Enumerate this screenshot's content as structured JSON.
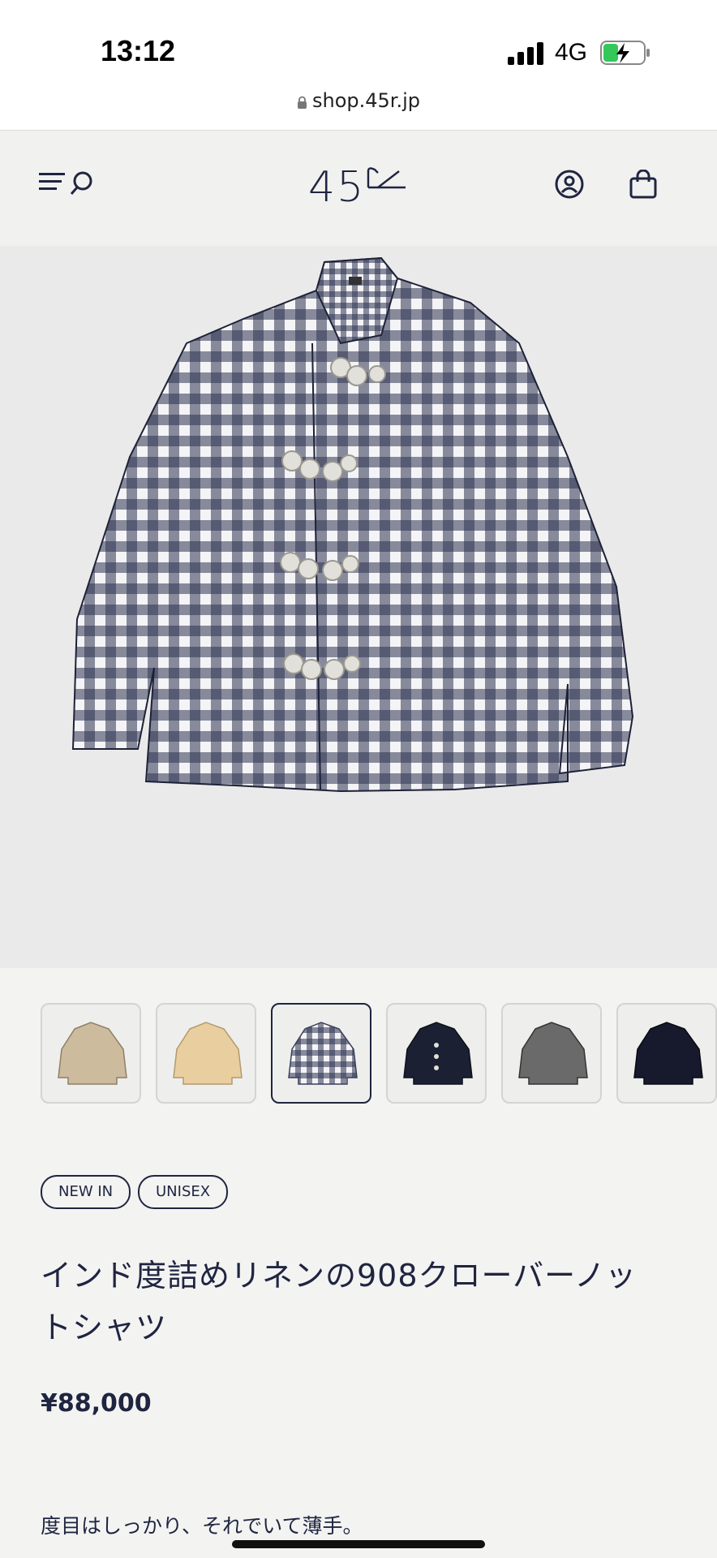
{
  "status_bar": {
    "time": "13:12",
    "network": "4G",
    "battery_color": "#34c759"
  },
  "browser": {
    "url": "shop.45r.jp",
    "lock_icon": "lock-icon"
  },
  "header": {
    "logo_text": "45",
    "menu_icon": "menu-icon",
    "search_icon": "search-icon",
    "account_icon": "user-icon",
    "cart_icon": "shopping-bag-icon"
  },
  "product": {
    "thumbnail_colors": [
      "#cdbb9e",
      "#e9cf9f",
      "#3a3f5c",
      "#1c2033",
      "#6a6a6a",
      "#161a2c"
    ],
    "active_thumbnail": 2,
    "tags": [
      "NEW IN",
      "UNISEX"
    ],
    "title": "インド度詰めリネンの908クローバーノットシャツ",
    "price": "¥88,000",
    "description": "度目はしっかり、それでいて薄手。"
  },
  "colors": {
    "navy": "#1f2540",
    "page_bg": "#f3f3f2"
  }
}
